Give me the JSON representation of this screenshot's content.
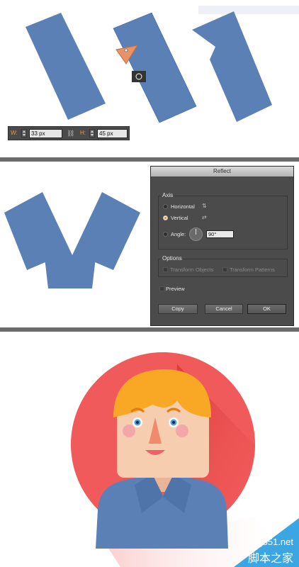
{
  "transform_bar": {
    "w_label": "W:",
    "w_value": "33 px",
    "h_label": "H:",
    "h_value": "45 px"
  },
  "reflect_dialog": {
    "title": "Reflect",
    "axis_group": "Axis",
    "horizontal_label": "Horizontal",
    "vertical_label": "Vertical",
    "selected_axis": "Vertical",
    "angle_label": "Angle:",
    "angle_value": "90°",
    "options_group": "Options",
    "transform_objects_label": "Transform Objects",
    "transform_patterns_label": "Transform Patterns",
    "preview_label": "Preview",
    "copy_button": "Copy",
    "cancel_button": "Cancel",
    "ok_button": "OK"
  },
  "colors": {
    "shape_blue": "#5b80b6",
    "circle_red": "#f15a5a",
    "hair": "#f9a825",
    "skin": "#f7cdb0",
    "jacket": "#5b80b6",
    "separator": "#6b6b6b"
  },
  "watermark": {
    "site": "jb51.net",
    "name": "脚本之家"
  }
}
